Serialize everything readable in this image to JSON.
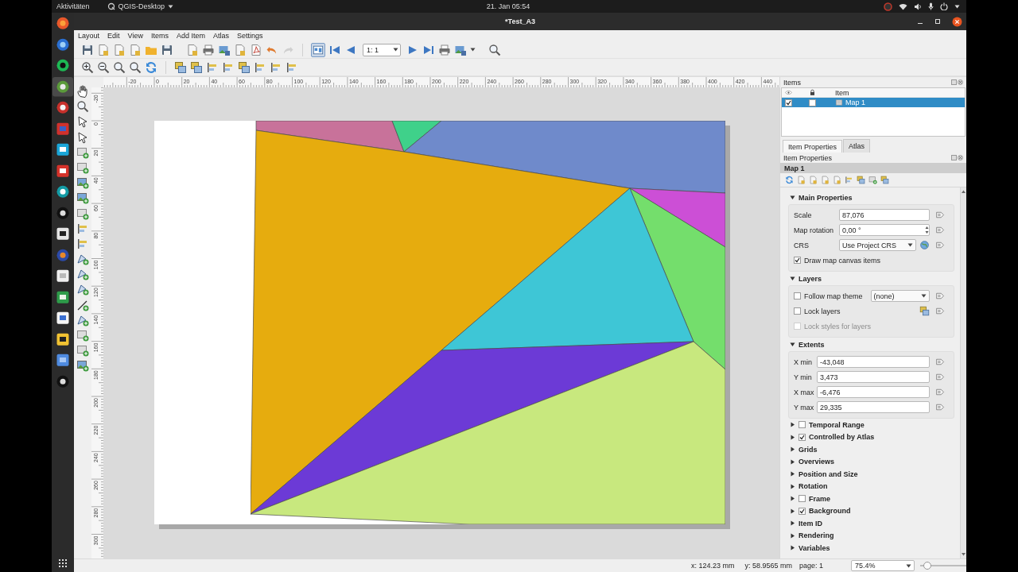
{
  "topbar": {
    "activities": "Aktivitäten",
    "app_menu": "QGIS-Desktop",
    "clock": "21. Jan 05:54"
  },
  "dock": [
    {
      "selected": false
    },
    {
      "selected": false
    },
    {
      "selected": false
    },
    {
      "selected": true
    },
    {
      "selected": false
    },
    {
      "selected": false
    },
    {
      "selected": false
    },
    {
      "selected": false
    },
    {
      "selected": false
    },
    {
      "selected": false
    },
    {
      "selected": false
    },
    {
      "selected": false
    },
    {
      "selected": false
    },
    {
      "selected": false
    },
    {
      "selected": false
    },
    {
      "selected": false
    },
    {
      "selected": false
    },
    {
      "selected": false
    }
  ],
  "window": {
    "title": "*Test_A3"
  },
  "menu": [
    "Layout",
    "Edit",
    "View",
    "Items",
    "Add Item",
    "Atlas",
    "Settings"
  ],
  "toolbar": {
    "atlas_preview_on": true,
    "atlas_page": "1: 1"
  },
  "rulers": {
    "x_labels": [
      "-20",
      "0",
      "20",
      "40",
      "60",
      "80",
      "100",
      "120",
      "140",
      "160",
      "180",
      "200",
      "220",
      "240",
      "260",
      "280",
      "300",
      "320",
      "340",
      "360",
      "380",
      "400",
      "420",
      "440"
    ],
    "y_labels": [
      "-20",
      "0",
      "20",
      "40",
      "60",
      "80",
      "100",
      "120",
      "140",
      "160",
      "180",
      "200",
      "220",
      "240",
      "260",
      "280",
      "300"
    ]
  },
  "items_panel": {
    "title": "Items",
    "column": "Item",
    "rows": [
      {
        "name": "Map 1",
        "visible": true,
        "locked": false,
        "selected": true
      }
    ]
  },
  "tabs": [
    {
      "label": "Item Properties",
      "selected": true
    },
    {
      "label": "Atlas",
      "selected": false
    }
  ],
  "properties": {
    "title": "Item Properties",
    "item_name": "Map 1",
    "sections": [
      {
        "kind": "group",
        "title": "Main Properties",
        "expanded": true,
        "rows": [
          {
            "kind": "field",
            "label": "Scale",
            "value": "87,076"
          },
          {
            "kind": "spin",
            "label": "Map rotation",
            "value": "0,00 °"
          },
          {
            "kind": "combo",
            "label": "CRS",
            "value": "Use Project CRS"
          },
          {
            "kind": "check",
            "label": "Draw map canvas items",
            "checked": true,
            "disabled": false
          }
        ]
      },
      {
        "kind": "group",
        "title": "Layers",
        "expanded": true,
        "rows": [
          {
            "kind": "check_combo",
            "label": "Follow map theme",
            "checked": false,
            "value": "(none)"
          },
          {
            "kind": "check_button",
            "label": "Lock layers",
            "checked": false
          },
          {
            "kind": "check",
            "label": "Lock styles for layers",
            "checked": false,
            "disabled": true
          }
        ]
      },
      {
        "kind": "group",
        "title": "Extents",
        "expanded": true,
        "rows": [
          {
            "kind": "short_field",
            "label": "X min",
            "value": "-43,048"
          },
          {
            "kind": "short_field",
            "label": "Y min",
            "value": "3,473"
          },
          {
            "kind": "short_field",
            "label": "X max",
            "value": "-6,476"
          },
          {
            "kind": "short_field",
            "label": "Y max",
            "value": "29,335"
          }
        ]
      },
      {
        "kind": "checkable",
        "title": "Temporal Range",
        "expanded": false,
        "checked": false
      },
      {
        "kind": "checkable",
        "title": "Controlled by Atlas",
        "expanded": false,
        "checked": true
      },
      {
        "kind": "group",
        "title": "Grids",
        "expanded": false
      },
      {
        "kind": "group",
        "title": "Overviews",
        "expanded": false
      },
      {
        "kind": "group",
        "title": "Position and Size",
        "expanded": false
      },
      {
        "kind": "group",
        "title": "Rotation",
        "expanded": false
      },
      {
        "kind": "checkable",
        "title": "Frame",
        "expanded": false,
        "checked": false
      },
      {
        "kind": "checkable",
        "title": "Background",
        "expanded": false,
        "checked": true
      },
      {
        "kind": "group",
        "title": "Item ID",
        "expanded": false
      },
      {
        "kind": "group",
        "title": "Rendering",
        "expanded": false
      },
      {
        "kind": "group",
        "title": "Variables",
        "expanded": false
      }
    ]
  },
  "status_bar": {
    "x": "x: 124.23 mm",
    "y": "y: 58.9565 mm",
    "page": "page: 1",
    "zoom": "75.4%",
    "zoom_slider": {
      "level": 0.08
    }
  }
}
